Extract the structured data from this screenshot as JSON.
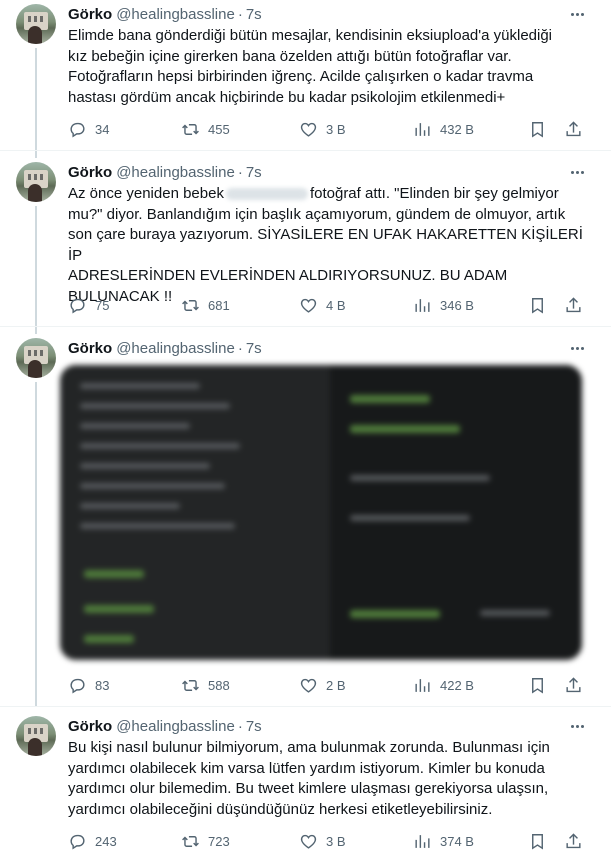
{
  "tweets": [
    {
      "name": "Görko",
      "handle": "@healingbassline",
      "time": "7s",
      "text": "Elimde bana gönderdiği bütün mesajlar, kendisinin eksiupload'a yüklediği\nkız bebeğin içine girerken bana özelden attığı bütün fotoğraflar var.\nFotoğrafların hepsi birbirinden iğrenç. Acilde çalışırken o kadar travma\nhastası gördüm ancak hiçbirinde bu kadar psikolojim etkilenmedi+",
      "replies": "34",
      "retweets": "455",
      "likes": "3 B",
      "views": "432 B"
    },
    {
      "name": "Görko",
      "handle": "@healingbassline",
      "time": "7s",
      "text_a": "Az önce yeniden bebek",
      "text_b": "fotoğraf attı. \"Elinden bir şey gelmiyor\nmu?\" diyor. Banlandığım için başlık açamıyorum, gündem de olmuyor, artık\nson çare buraya yazıyorum. SİYASİLERE EN UFAK HAKARETTEN KİŞİLERİ İP\nADRESLERİNDEN EVLERİNDEN ALDIRIYORSUNUZ. BU ADAM\nBULUNACAK !!",
      "replies": "75",
      "retweets": "681",
      "likes": "4 B",
      "views": "346 B"
    },
    {
      "name": "Görko",
      "handle": "@healingbassline",
      "time": "7s",
      "replies": "83",
      "retweets": "588",
      "likes": "2 B",
      "views": "422 B"
    },
    {
      "name": "Görko",
      "handle": "@healingbassline",
      "time": "7s",
      "text": "Bu kişi nasıl bulunur bilmiyorum, ama bulunmak zorunda. Bulunması için\nyardımcı olabilecek kim varsa lütfen yardım istiyorum. Kimler bu konuda\nyardımcı olur bilemedim. Bu tweet kimlere ulaşması gerekiyorsa ulaşsın,\nyardımcı olabileceğini düşündüğünüz herkesi etiketleyebilirsiniz.",
      "replies": "243",
      "retweets": "723",
      "likes": "3 B",
      "views": "374 B"
    }
  ],
  "icons": {
    "reply": "reply-icon",
    "retweet": "retweet-icon",
    "like": "heart-icon",
    "views": "views-icon",
    "bookmark": "bookmark-icon",
    "share": "share-icon",
    "more": "more-icon"
  },
  "colors": {
    "text": "#0f1419",
    "muted": "#536471",
    "thread": "#cfd9de",
    "divider": "#eff3f4"
  }
}
